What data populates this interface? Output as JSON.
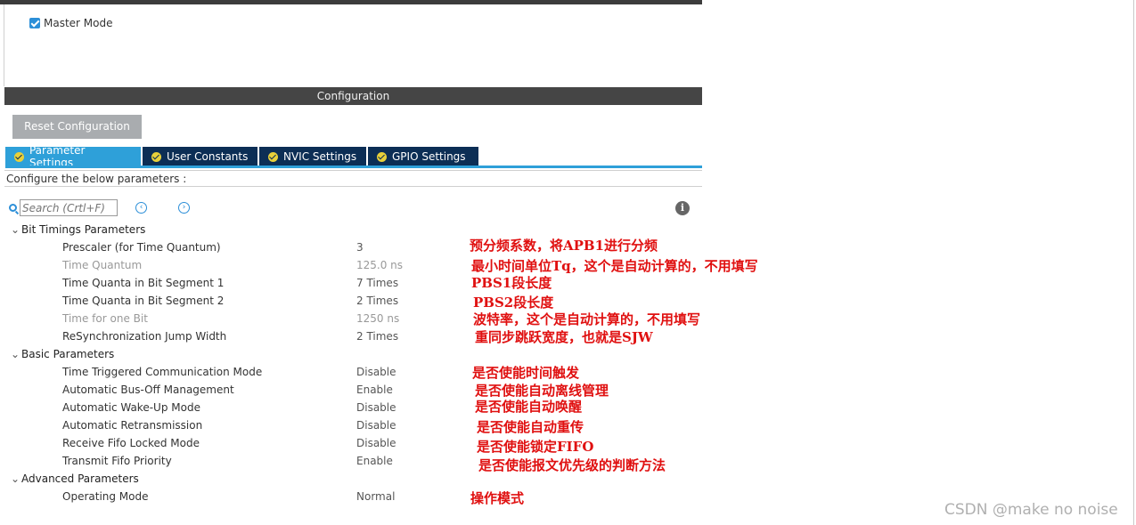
{
  "mode": {
    "checkbox_label": "Master Mode",
    "checked": true
  },
  "configuration": {
    "header": "Configuration",
    "reset_button": "Reset Configuration",
    "tabs": [
      {
        "label": "Parameter Settings",
        "active": true
      },
      {
        "label": "User Constants",
        "active": false
      },
      {
        "label": "NVIC Settings",
        "active": false
      },
      {
        "label": "GPIO Settings",
        "active": false
      }
    ],
    "instructions": "Configure the below parameters :",
    "search_placeholder": "Search (Crtl+F)"
  },
  "groups": {
    "bit_timings": {
      "label": "Bit Timings Parameters",
      "params": [
        {
          "label": "Prescaler (for Time Quantum)",
          "value": "3"
        },
        {
          "label": "Time Quantum",
          "value": "125.0 ns"
        },
        {
          "label": "Time Quanta in Bit Segment 1",
          "value": "7 Times"
        },
        {
          "label": "Time Quanta in Bit Segment 2",
          "value": "2 Times"
        },
        {
          "label": "Time for one Bit",
          "value": "1250 ns"
        },
        {
          "label": "ReSynchronization Jump Width",
          "value": "2 Times"
        }
      ]
    },
    "basic": {
      "label": "Basic Parameters",
      "params": [
        {
          "label": "Time Triggered Communication Mode",
          "value": "Disable"
        },
        {
          "label": "Automatic Bus-Off Management",
          "value": "Enable"
        },
        {
          "label": "Automatic Wake-Up Mode",
          "value": "Disable"
        },
        {
          "label": "Automatic Retransmission",
          "value": "Disable"
        },
        {
          "label": "Receive Fifo Locked Mode",
          "value": "Disable"
        },
        {
          "label": "Transmit Fifo Priority",
          "value": "Enable"
        }
      ]
    },
    "advanced": {
      "label": "Advanced Parameters",
      "params": [
        {
          "label": "Operating Mode",
          "value": "Normal"
        }
      ]
    }
  },
  "annotations": [
    "预分频系数，将APB1进行分频",
    "最小时间单位Tq，这个是自动计算的，不用填写",
    "PBS1段长度",
    "PBS2段长度",
    "波特率，这个是自动计算的，不用填写",
    "重同步跳跃宽度，也就是SJW",
    "是否使能时间触发",
    "是否使能自动离线管理",
    "是否使能自动唤醒",
    "是否使能自动重传",
    "是否使能锁定FIFO",
    "是否使能报文优先级的判断方法",
    "操作模式"
  ],
  "watermark": "CSDN @make no noise",
  "colors": {
    "tab_active": "#2ea0d9",
    "tab_inactive": "#0c2e55",
    "header_bg": "#454545",
    "annotation": "#e01010"
  }
}
